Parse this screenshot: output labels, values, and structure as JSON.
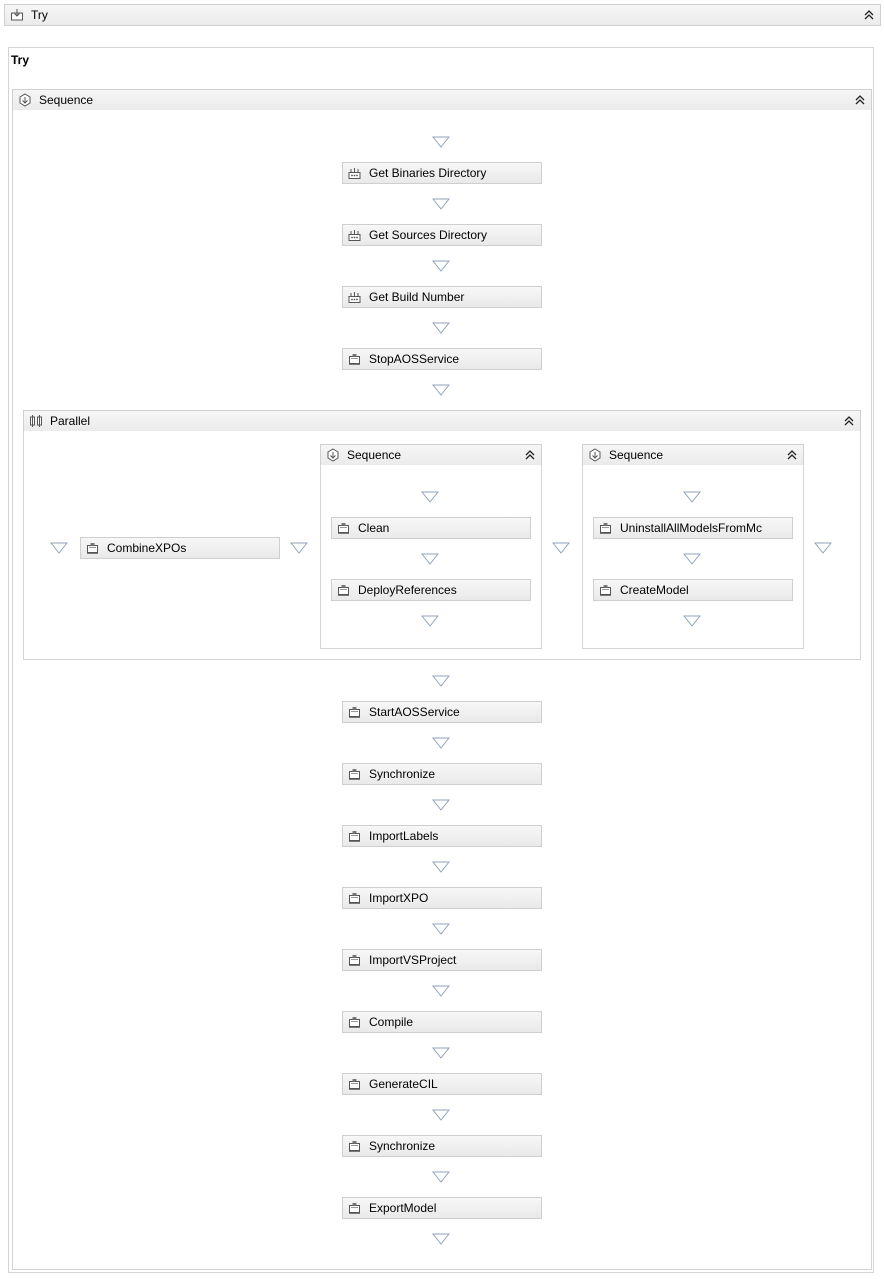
{
  "try_header": {
    "title": "Try",
    "icon": "try-icon"
  },
  "try_block": {
    "label": "Try"
  },
  "sequence_main": {
    "title": "Sequence",
    "icon": "sequence-icon"
  },
  "activities_top": [
    {
      "label": "Get Binaries Directory",
      "icon": "assign-icon"
    },
    {
      "label": "Get Sources Directory",
      "icon": "assign-icon"
    },
    {
      "label": "Get Build Number",
      "icon": "assign-icon"
    },
    {
      "label": "StopAOSService",
      "icon": "activity-icon"
    }
  ],
  "parallel": {
    "title": "Parallel",
    "icon": "parallel-icon",
    "branch1": {
      "label": "CombineXPOs",
      "icon": "activity-icon"
    },
    "seq2": {
      "title": "Sequence",
      "items": [
        {
          "label": "Clean",
          "icon": "activity-icon"
        },
        {
          "label": "DeployReferences",
          "icon": "activity-icon"
        }
      ]
    },
    "seq3": {
      "title": "Sequence",
      "items": [
        {
          "label": "UninstallAllModelsFromMc",
          "icon": "activity-icon"
        },
        {
          "label": "CreateModel",
          "icon": "activity-icon"
        }
      ]
    }
  },
  "activities_bottom": [
    {
      "label": "StartAOSService",
      "icon": "activity-icon"
    },
    {
      "label": "Synchronize",
      "icon": "activity-icon"
    },
    {
      "label": "ImportLabels",
      "icon": "activity-icon"
    },
    {
      "label": "ImportXPO",
      "icon": "activity-icon"
    },
    {
      "label": "ImportVSProject",
      "icon": "activity-icon"
    },
    {
      "label": "Compile",
      "icon": "activity-icon"
    },
    {
      "label": "GenerateCIL",
      "icon": "activity-icon"
    },
    {
      "label": "Synchronize",
      "icon": "activity-icon"
    },
    {
      "label": "ExportModel",
      "icon": "activity-icon"
    }
  ],
  "colors": {
    "header_bg": "#ececec",
    "border": "#d0d0d0",
    "triangle": "#8fa2b8"
  }
}
